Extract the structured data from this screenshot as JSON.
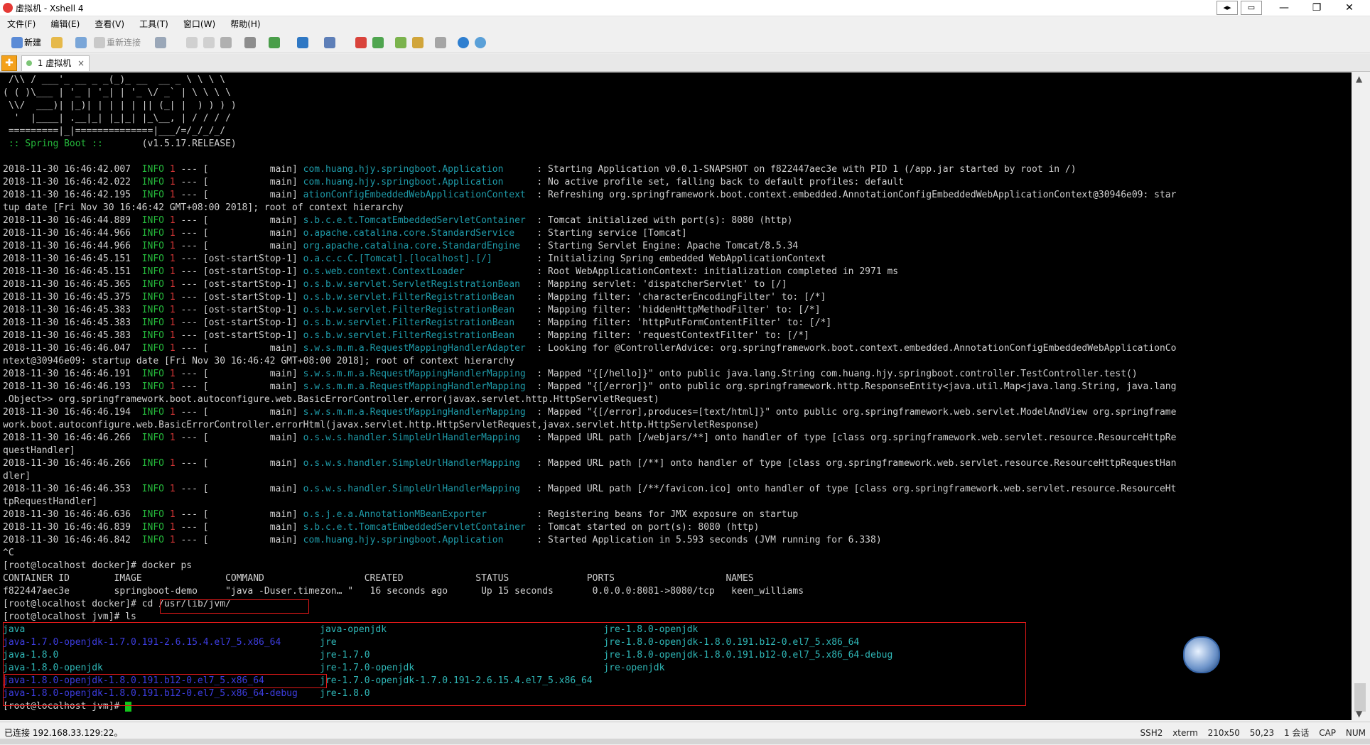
{
  "window": {
    "title": "虚拟机 - Xshell 4"
  },
  "menu": [
    "文件(F)",
    "编辑(E)",
    "查看(V)",
    "工具(T)",
    "窗口(W)",
    "帮助(H)"
  ],
  "toolbar": {
    "new_label": "新建",
    "reconnect_label": "重新连接"
  },
  "tabs": [
    {
      "label": "1 虚拟机"
    }
  ],
  "terminal": {
    "lines": [
      [
        {
          "t": " /\\\\ / ___'_ __ _ _(_)_ __  __ _ \\ \\ \\ \\",
          "c": "w"
        }
      ],
      [
        {
          "t": "( ( )\\___ | '_ | '_| | '_ \\/ _` | \\ \\ \\ \\",
          "c": "w"
        }
      ],
      [
        {
          "t": " \\\\/  ___)| |_)| | | | | || (_| |  ) ) ) )",
          "c": "w"
        }
      ],
      [
        {
          "t": "  '  |____| .__|_| |_|_| |_\\__, | / / / /",
          "c": "w"
        }
      ],
      [
        {
          "t": " =========|_|==============|___/=/_/_/_/",
          "c": "w"
        }
      ],
      [
        {
          "t": " :: Spring Boot ::",
          "c": "g"
        },
        {
          "t": "       (v1.5.17.RELEASE)",
          "c": "w"
        }
      ],
      [
        {
          "t": "",
          "c": "w"
        }
      ],
      [
        {
          "t": "2018-11-30 16:46:42.007  ",
          "c": "w"
        },
        {
          "t": "INFO ",
          "c": "g"
        },
        {
          "t": "1",
          "c": "r"
        },
        {
          "t": " --- [           main] ",
          "c": "w"
        },
        {
          "t": "com.huang.hjy.springboot.Application     ",
          "c": "c"
        },
        {
          "t": " : Starting Application v0.0.1-SNAPSHOT on f822447aec3e with PID 1 (/app.jar started by root in /)",
          "c": "w"
        }
      ],
      [
        {
          "t": "2018-11-30 16:46:42.022  ",
          "c": "w"
        },
        {
          "t": "INFO ",
          "c": "g"
        },
        {
          "t": "1",
          "c": "r"
        },
        {
          "t": " --- [           main] ",
          "c": "w"
        },
        {
          "t": "com.huang.hjy.springboot.Application     ",
          "c": "c"
        },
        {
          "t": " : No active profile set, falling back to default profiles: default",
          "c": "w"
        }
      ],
      [
        {
          "t": "2018-11-30 16:46:42.195  ",
          "c": "w"
        },
        {
          "t": "INFO ",
          "c": "g"
        },
        {
          "t": "1",
          "c": "r"
        },
        {
          "t": " --- [           main] ",
          "c": "w"
        },
        {
          "t": "ationConfigEmbeddedWebApplicationContext ",
          "c": "c"
        },
        {
          "t": " : Refreshing org.springframework.boot.context.embedded.AnnotationConfigEmbeddedWebApplicationContext@30946e09: star",
          "c": "w"
        }
      ],
      [
        {
          "t": "tup date [Fri Nov 30 16:46:42 GMT+08:00 2018]; root of context hierarchy",
          "c": "w"
        }
      ],
      [
        {
          "t": "2018-11-30 16:46:44.889  ",
          "c": "w"
        },
        {
          "t": "INFO ",
          "c": "g"
        },
        {
          "t": "1",
          "c": "r"
        },
        {
          "t": " --- [           main] ",
          "c": "w"
        },
        {
          "t": "s.b.c.e.t.TomcatEmbeddedServletContainer ",
          "c": "c"
        },
        {
          "t": " : Tomcat initialized with port(s): 8080 (http)",
          "c": "w"
        }
      ],
      [
        {
          "t": "2018-11-30 16:46:44.966  ",
          "c": "w"
        },
        {
          "t": "INFO ",
          "c": "g"
        },
        {
          "t": "1",
          "c": "r"
        },
        {
          "t": " --- [           main] ",
          "c": "w"
        },
        {
          "t": "o.apache.catalina.core.StandardService   ",
          "c": "c"
        },
        {
          "t": " : Starting service [Tomcat]",
          "c": "w"
        }
      ],
      [
        {
          "t": "2018-11-30 16:46:44.966  ",
          "c": "w"
        },
        {
          "t": "INFO ",
          "c": "g"
        },
        {
          "t": "1",
          "c": "r"
        },
        {
          "t": " --- [           main] ",
          "c": "w"
        },
        {
          "t": "org.apache.catalina.core.StandardEngine  ",
          "c": "c"
        },
        {
          "t": " : Starting Servlet Engine: Apache Tomcat/8.5.34",
          "c": "w"
        }
      ],
      [
        {
          "t": "2018-11-30 16:46:45.151  ",
          "c": "w"
        },
        {
          "t": "INFO ",
          "c": "g"
        },
        {
          "t": "1",
          "c": "r"
        },
        {
          "t": " --- [ost-startStop-1] ",
          "c": "w"
        },
        {
          "t": "o.a.c.c.C.[Tomcat].[localhost].[/]       ",
          "c": "c"
        },
        {
          "t": " : Initializing Spring embedded WebApplicationContext",
          "c": "w"
        }
      ],
      [
        {
          "t": "2018-11-30 16:46:45.151  ",
          "c": "w"
        },
        {
          "t": "INFO ",
          "c": "g"
        },
        {
          "t": "1",
          "c": "r"
        },
        {
          "t": " --- [ost-startStop-1] ",
          "c": "w"
        },
        {
          "t": "o.s.web.context.ContextLoader            ",
          "c": "c"
        },
        {
          "t": " : Root WebApplicationContext: initialization completed in 2971 ms",
          "c": "w"
        }
      ],
      [
        {
          "t": "2018-11-30 16:46:45.365  ",
          "c": "w"
        },
        {
          "t": "INFO ",
          "c": "g"
        },
        {
          "t": "1",
          "c": "r"
        },
        {
          "t": " --- [ost-startStop-1] ",
          "c": "w"
        },
        {
          "t": "o.s.b.w.servlet.ServletRegistrationBean  ",
          "c": "c"
        },
        {
          "t": " : Mapping servlet: 'dispatcherServlet' to [/]",
          "c": "w"
        }
      ],
      [
        {
          "t": "2018-11-30 16:46:45.375  ",
          "c": "w"
        },
        {
          "t": "INFO ",
          "c": "g"
        },
        {
          "t": "1",
          "c": "r"
        },
        {
          "t": " --- [ost-startStop-1] ",
          "c": "w"
        },
        {
          "t": "o.s.b.w.servlet.FilterRegistrationBean   ",
          "c": "c"
        },
        {
          "t": " : Mapping filter: 'characterEncodingFilter' to: [/*]",
          "c": "w"
        }
      ],
      [
        {
          "t": "2018-11-30 16:46:45.383  ",
          "c": "w"
        },
        {
          "t": "INFO ",
          "c": "g"
        },
        {
          "t": "1",
          "c": "r"
        },
        {
          "t": " --- [ost-startStop-1] ",
          "c": "w"
        },
        {
          "t": "o.s.b.w.servlet.FilterRegistrationBean   ",
          "c": "c"
        },
        {
          "t": " : Mapping filter: 'hiddenHttpMethodFilter' to: [/*]",
          "c": "w"
        }
      ],
      [
        {
          "t": "2018-11-30 16:46:45.383  ",
          "c": "w"
        },
        {
          "t": "INFO ",
          "c": "g"
        },
        {
          "t": "1",
          "c": "r"
        },
        {
          "t": " --- [ost-startStop-1] ",
          "c": "w"
        },
        {
          "t": "o.s.b.w.servlet.FilterRegistrationBean   ",
          "c": "c"
        },
        {
          "t": " : Mapping filter: 'httpPutFormContentFilter' to: [/*]",
          "c": "w"
        }
      ],
      [
        {
          "t": "2018-11-30 16:46:45.383  ",
          "c": "w"
        },
        {
          "t": "INFO ",
          "c": "g"
        },
        {
          "t": "1",
          "c": "r"
        },
        {
          "t": " --- [ost-startStop-1] ",
          "c": "w"
        },
        {
          "t": "o.s.b.w.servlet.FilterRegistrationBean   ",
          "c": "c"
        },
        {
          "t": " : Mapping filter: 'requestContextFilter' to: [/*]",
          "c": "w"
        }
      ],
      [
        {
          "t": "2018-11-30 16:46:46.047  ",
          "c": "w"
        },
        {
          "t": "INFO ",
          "c": "g"
        },
        {
          "t": "1",
          "c": "r"
        },
        {
          "t": " --- [           main] ",
          "c": "w"
        },
        {
          "t": "s.w.s.m.m.a.RequestMappingHandlerAdapter ",
          "c": "c"
        },
        {
          "t": " : Looking for @ControllerAdvice: org.springframework.boot.context.embedded.AnnotationConfigEmbeddedWebApplicationCo",
          "c": "w"
        }
      ],
      [
        {
          "t": "ntext@30946e09: startup date [Fri Nov 30 16:46:42 GMT+08:00 2018]; root of context hierarchy",
          "c": "w"
        }
      ],
      [
        {
          "t": "2018-11-30 16:46:46.191  ",
          "c": "w"
        },
        {
          "t": "INFO ",
          "c": "g"
        },
        {
          "t": "1",
          "c": "r"
        },
        {
          "t": " --- [           main] ",
          "c": "w"
        },
        {
          "t": "s.w.s.m.m.a.RequestMappingHandlerMapping ",
          "c": "c"
        },
        {
          "t": " : Mapped \"{[/hello]}\" onto public java.lang.String com.huang.hjy.springboot.controller.TestController.test()",
          "c": "w"
        }
      ],
      [
        {
          "t": "2018-11-30 16:46:46.193  ",
          "c": "w"
        },
        {
          "t": "INFO ",
          "c": "g"
        },
        {
          "t": "1",
          "c": "r"
        },
        {
          "t": " --- [           main] ",
          "c": "w"
        },
        {
          "t": "s.w.s.m.m.a.RequestMappingHandlerMapping ",
          "c": "c"
        },
        {
          "t": " : Mapped \"{[/error]}\" onto public org.springframework.http.ResponseEntity<java.util.Map<java.lang.String, java.lang",
          "c": "w"
        }
      ],
      [
        {
          "t": ".Object>> org.springframework.boot.autoconfigure.web.BasicErrorController.error(javax.servlet.http.HttpServletRequest)",
          "c": "w"
        }
      ],
      [
        {
          "t": "2018-11-30 16:46:46.194  ",
          "c": "w"
        },
        {
          "t": "INFO ",
          "c": "g"
        },
        {
          "t": "1",
          "c": "r"
        },
        {
          "t": " --- [           main] ",
          "c": "w"
        },
        {
          "t": "s.w.s.m.m.a.RequestMappingHandlerMapping ",
          "c": "c"
        },
        {
          "t": " : Mapped \"{[/error],produces=[text/html]}\" onto public org.springframework.web.servlet.ModelAndView org.springframe",
          "c": "w"
        }
      ],
      [
        {
          "t": "work.boot.autoconfigure.web.BasicErrorController.errorHtml(javax.servlet.http.HttpServletRequest,javax.servlet.http.HttpServletResponse)",
          "c": "w"
        }
      ],
      [
        {
          "t": "2018-11-30 16:46:46.266  ",
          "c": "w"
        },
        {
          "t": "INFO ",
          "c": "g"
        },
        {
          "t": "1",
          "c": "r"
        },
        {
          "t": " --- [           main] ",
          "c": "w"
        },
        {
          "t": "o.s.w.s.handler.SimpleUrlHandlerMapping  ",
          "c": "c"
        },
        {
          "t": " : Mapped URL path [/webjars/**] onto handler of type [class org.springframework.web.servlet.resource.ResourceHttpRe",
          "c": "w"
        }
      ],
      [
        {
          "t": "questHandler]",
          "c": "w"
        }
      ],
      [
        {
          "t": "2018-11-30 16:46:46.266  ",
          "c": "w"
        },
        {
          "t": "INFO ",
          "c": "g"
        },
        {
          "t": "1",
          "c": "r"
        },
        {
          "t": " --- [           main] ",
          "c": "w"
        },
        {
          "t": "o.s.w.s.handler.SimpleUrlHandlerMapping  ",
          "c": "c"
        },
        {
          "t": " : Mapped URL path [/**] onto handler of type [class org.springframework.web.servlet.resource.ResourceHttpRequestHan",
          "c": "w"
        }
      ],
      [
        {
          "t": "dler]",
          "c": "w"
        }
      ],
      [
        {
          "t": "2018-11-30 16:46:46.353  ",
          "c": "w"
        },
        {
          "t": "INFO ",
          "c": "g"
        },
        {
          "t": "1",
          "c": "r"
        },
        {
          "t": " --- [           main] ",
          "c": "w"
        },
        {
          "t": "o.s.w.s.handler.SimpleUrlHandlerMapping  ",
          "c": "c"
        },
        {
          "t": " : Mapped URL path [/**/favicon.ico] onto handler of type [class org.springframework.web.servlet.resource.ResourceHt",
          "c": "w"
        }
      ],
      [
        {
          "t": "tpRequestHandler]",
          "c": "w"
        }
      ],
      [
        {
          "t": "2018-11-30 16:46:46.636  ",
          "c": "w"
        },
        {
          "t": "INFO ",
          "c": "g"
        },
        {
          "t": "1",
          "c": "r"
        },
        {
          "t": " --- [           main] ",
          "c": "w"
        },
        {
          "t": "o.s.j.e.a.AnnotationMBeanExporter        ",
          "c": "c"
        },
        {
          "t": " : Registering beans for JMX exposure on startup",
          "c": "w"
        }
      ],
      [
        {
          "t": "2018-11-30 16:46:46.839  ",
          "c": "w"
        },
        {
          "t": "INFO ",
          "c": "g"
        },
        {
          "t": "1",
          "c": "r"
        },
        {
          "t": " --- [           main] ",
          "c": "w"
        },
        {
          "t": "s.b.c.e.t.TomcatEmbeddedServletContainer ",
          "c": "c"
        },
        {
          "t": " : Tomcat started on port(s): 8080 (http)",
          "c": "w"
        }
      ],
      [
        {
          "t": "2018-11-30 16:46:46.842  ",
          "c": "w"
        },
        {
          "t": "INFO ",
          "c": "g"
        },
        {
          "t": "1",
          "c": "r"
        },
        {
          "t": " --- [           main] ",
          "c": "w"
        },
        {
          "t": "com.huang.hjy.springboot.Application     ",
          "c": "c"
        },
        {
          "t": " : Started Application in 5.593 seconds (JVM running for 6.338)",
          "c": "w"
        }
      ],
      [
        {
          "t": "^C",
          "c": "w"
        }
      ],
      [
        {
          "t": "[root@localhost docker]# docker ps",
          "c": "w"
        }
      ],
      [
        {
          "t": "CONTAINER ID        IMAGE               COMMAND                  CREATED             STATUS              PORTS                    NAMES",
          "c": "w"
        }
      ],
      [
        {
          "t": "f822447aec3e        springboot-demo     \"java -Duser.timezon… \"   16 seconds ago      Up 15 seconds       0.0.0.0:8081->8080/tcp   keen_williams",
          "c": "w"
        }
      ],
      [
        {
          "t": "[root@localhost docker]# ",
          "c": "w"
        },
        {
          "t": "cd /usr/lib/jvm/",
          "c": "w"
        }
      ],
      [
        {
          "t": "[root@localhost jvm]# ls",
          "c": "w"
        }
      ],
      [
        {
          "t": "java                                                     ",
          "c": "t"
        },
        {
          "t": "java-openjdk                                       ",
          "c": "t"
        },
        {
          "t": "jre-1.8.0-openjdk",
          "c": "t"
        }
      ],
      [
        {
          "t": "java-1.7.0-openjdk-1.7.0.191-2.6.15.4.el7_5.x86_64       ",
          "c": "b"
        },
        {
          "t": "jre                                                ",
          "c": "t"
        },
        {
          "t": "jre-1.8.0-openjdk-1.8.0.191.b12-0.el7_5.x86_64",
          "c": "t"
        }
      ],
      [
        {
          "t": "java-1.8.0                                               ",
          "c": "t"
        },
        {
          "t": "jre-1.7.0                                          ",
          "c": "t"
        },
        {
          "t": "jre-1.8.0-openjdk-1.8.0.191.b12-0.el7_5.x86_64-debug",
          "c": "t"
        }
      ],
      [
        {
          "t": "java-1.8.0-openjdk                                       ",
          "c": "t"
        },
        {
          "t": "jre-1.7.0-openjdk                                  ",
          "c": "t"
        },
        {
          "t": "jre-openjdk",
          "c": "t"
        }
      ],
      [
        {
          "t": "java-1.8.0-openjdk-1.8.0.191.b12-0.el7_5.x86_64          ",
          "c": "b"
        },
        {
          "t": "jre-1.7.0-openjdk-1.7.0.191-2.6.15.4.el7_5.x86_64",
          "c": "t"
        }
      ],
      [
        {
          "t": "java-1.8.0-openjdk-1.8.0.191.b12-0.el7_5.x86_64-debug    ",
          "c": "b"
        },
        {
          "t": "jre-1.8.0",
          "c": "t"
        }
      ],
      [
        {
          "t": "[root@localhost jvm]# ",
          "c": "w"
        }
      ]
    ]
  },
  "status": {
    "connection": "已连接 192.168.33.129:22。",
    "protocol": "SSH2",
    "terminal_type": "xterm",
    "size": "210x50",
    "cursor_pos": "50,23",
    "sessions": "1 会话",
    "caps": "CAP",
    "num": "NUM"
  }
}
